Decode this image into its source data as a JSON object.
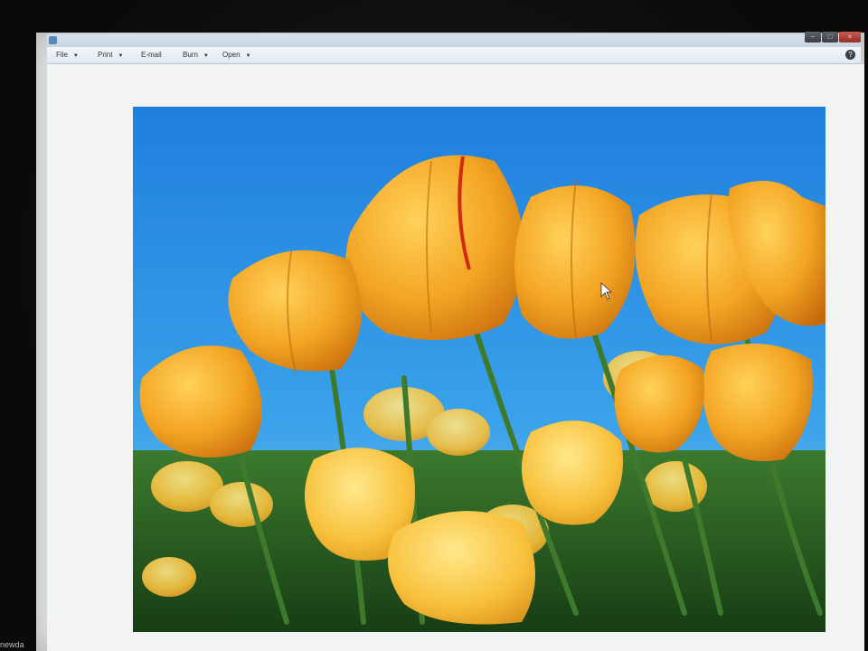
{
  "window": {
    "title": "",
    "controls": {
      "minimize": "",
      "maximize": "",
      "close": ""
    }
  },
  "menu": {
    "items": [
      {
        "label": "File",
        "has_dropdown": true
      },
      {
        "label": "Print",
        "has_dropdown": true
      },
      {
        "label": "E-mail",
        "has_dropdown": false
      },
      {
        "label": "Burn",
        "has_dropdown": true
      },
      {
        "label": "Open",
        "has_dropdown": true
      }
    ],
    "help_icon": "help-icon"
  },
  "viewer": {
    "image_subject": "yellow tulips against blue sky"
  },
  "watermark": "newda",
  "colors": {
    "sky": "#2a8fe0",
    "tulip": "#f2a21c",
    "foliage": "#2e6a2a",
    "frame": "#e9ecec"
  }
}
